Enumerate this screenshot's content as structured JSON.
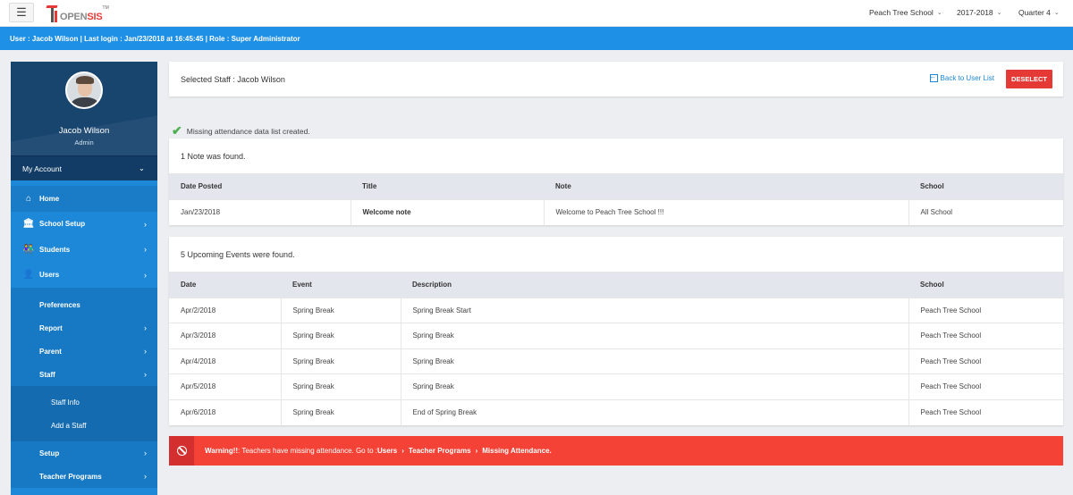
{
  "top": {
    "school": "Peach Tree School",
    "year": "2017-2018",
    "quarter": "Quarter 4",
    "logo": {
      "part1": "OPEN",
      "part2": "SIS",
      "tm": "TM"
    }
  },
  "userbar": {
    "text": "User : Jacob Wilson | Last login : Jan/23/2018 at 16:45:45 | Role : Super Administrator"
  },
  "profile": {
    "name": "Jacob Wilson",
    "role": "Admin",
    "account": "My Account"
  },
  "nav": {
    "home": "Home",
    "school_setup": "School Setup",
    "students": "Students",
    "users": "Users",
    "preferences": "Preferences",
    "report": "Report",
    "parent": "Parent",
    "staff": "Staff",
    "staff_info": "Staff Info",
    "add_staff": "Add a Staff",
    "setup": "Setup",
    "teacher_programs": "Teacher Programs"
  },
  "selected": {
    "label": "Selected Staff : Jacob  Wilson",
    "back": "Back to User List",
    "deselect": "DESELECT"
  },
  "message": "Missing attendance data list created.",
  "notes": {
    "title": "1 Note was found.",
    "headers": [
      "Date Posted",
      "Title",
      "Note",
      "School"
    ],
    "rows": [
      [
        "Jan/23/2018",
        "Welcome note",
        "Welcome to Peach Tree School !!!",
        "All School"
      ]
    ]
  },
  "events": {
    "title": "5 Upcoming Events were found.",
    "headers": [
      "Date",
      "Event",
      "Description",
      "School"
    ],
    "rows": [
      [
        "Apr/2/2018",
        "Spring Break",
        "Spring Break Start",
        "Peach Tree School"
      ],
      [
        "Apr/3/2018",
        "Spring Break",
        "Spring Break",
        "Peach Tree School"
      ],
      [
        "Apr/4/2018",
        "Spring Break",
        "Spring Break",
        "Peach Tree School"
      ],
      [
        "Apr/5/2018",
        "Spring Break",
        "Spring Break",
        "Peach Tree School"
      ],
      [
        "Apr/6/2018",
        "Spring Break",
        "End of Spring Break",
        "Peach Tree School"
      ]
    ]
  },
  "warning": {
    "prefix": "Warning!!",
    "text": " : Teachers have missing attendance. Go to : ",
    "link1": "Users",
    "link2": "Teacher Programs",
    "link3": "Missing Attendance.",
    "arrow": "›"
  }
}
